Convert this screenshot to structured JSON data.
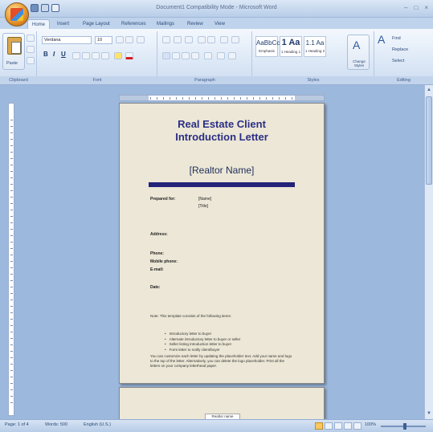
{
  "window": {
    "title": "Document1 Compatibility Mode - Microsoft Word",
    "controls": [
      "–",
      "□",
      "×"
    ]
  },
  "tabs": [
    "Home",
    "Insert",
    "Page Layout",
    "References",
    "Mailings",
    "Review",
    "View"
  ],
  "ribbon": {
    "clipboard": {
      "label": "Clipboard",
      "paste": "Paste"
    },
    "font": {
      "label": "Font",
      "family": "Verdana",
      "size": "10"
    },
    "paragraph": {
      "label": "Paragraph"
    },
    "styles": {
      "label": "Styles",
      "items": [
        {
          "sample": "AaBbCcD",
          "name": "Emphasis"
        },
        {
          "sample": "1 Aa",
          "name": "1 Heading 1"
        },
        {
          "sample": "1.1 Aa",
          "name": "1 Heading 2"
        }
      ],
      "change_styles": "Change Styles"
    },
    "editing": {
      "label": "Editing",
      "find": "Find",
      "replace": "Replace",
      "select": "Select"
    }
  },
  "document": {
    "title_line1": "Real Estate Client",
    "title_line2": "Introduction Letter",
    "realtor_name": "[Realtor Name]",
    "prepared_for_label": "Prepared for:",
    "prepared_for_values": [
      "[Name]",
      "[Title]"
    ],
    "address_label": "Address:",
    "phone_label": "Phone:",
    "mobile_label": "Mobile phone:",
    "email_label": "E-mail:",
    "date_label": "Date:",
    "intro_text": "Note: This template consists of the following items:",
    "bullets": [
      "Introductory letter to buyer",
      "Alternate introductory letter to buyer or seller",
      "Seller listing introduction letter to buyer",
      "Form letter to notify client/buyer"
    ],
    "closing_text": "You can customize each letter by updating the placeholder text. Add your name and logo to the top of the letter. Alternatively, you can delete the logo placeholder. Print all the letters on your company letterhead paper.",
    "page2_footer": "Realtor name"
  },
  "status": {
    "page": "Page: 1 of 4",
    "words": "Words: 500",
    "language": "English (U.S.)",
    "zoom": "100%"
  },
  "colors": {
    "title_text": "#2b2f86",
    "rule_bar": "#23237a",
    "page_background": "#ece7d6"
  }
}
